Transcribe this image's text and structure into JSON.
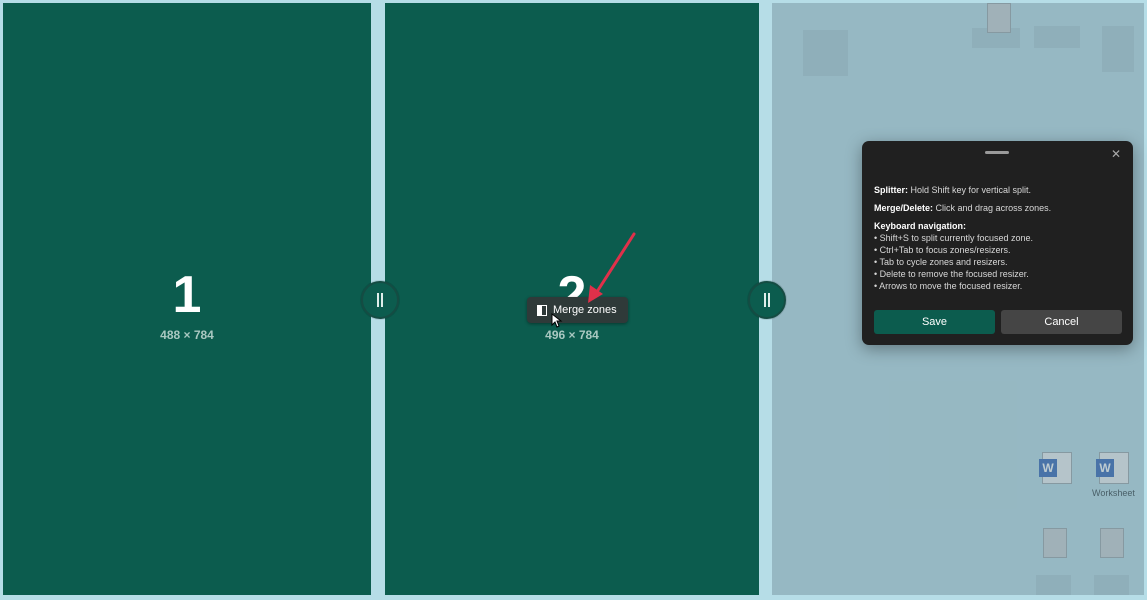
{
  "zones": [
    {
      "number": "1",
      "size": "488 × 784"
    },
    {
      "number": "2",
      "size": "496 × 784"
    }
  ],
  "merge_tooltip": {
    "label": "Merge zones"
  },
  "dialog": {
    "splitter_title": "Splitter:",
    "splitter_text": " Hold Shift key for vertical split.",
    "merge_title": "Merge/Delete:",
    "merge_text": " Click and drag across zones.",
    "keyboard_title": "Keyboard navigation:",
    "keyboard_items": [
      "• Shift+S to split currently focused zone.",
      "• Ctrl+Tab to focus zones/resizers.",
      "• Tab to cycle zones and resizers.",
      "• Delete to remove the focused resizer.",
      "• Arrows to move the focused resizer."
    ],
    "save_label": "Save",
    "cancel_label": "Cancel"
  },
  "desktop": {
    "caption": "Worksheet"
  },
  "colors": {
    "zone": "#0c5c4e",
    "dialog_bg": "#202020",
    "cancel_bg": "#454545",
    "arrow": "#e0304a"
  }
}
